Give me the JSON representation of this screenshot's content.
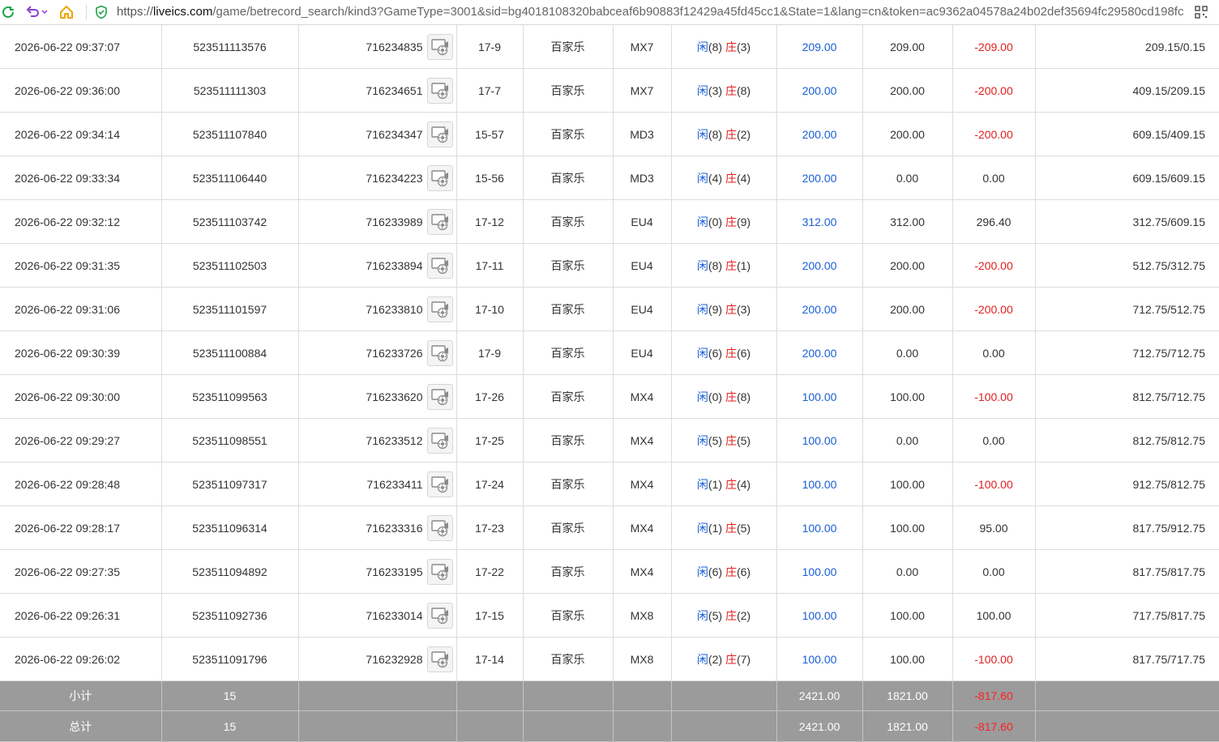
{
  "browser": {
    "url_scheme": "https://",
    "url_host": "liveics.com",
    "url_path": "/game/betrecord_search/kind3?GameType=3001&sid=bg4018108320babceaf6b90883f12429a45fd45cc1&State=1&lang=cn&token=ac9362a04578a24b02def35694fc29580cd198fc"
  },
  "colors": {
    "player": "#1a5fd6",
    "banker": "#e02020",
    "summary_bg": "#9b9b9b"
  },
  "rows": [
    {
      "time": "2026-06-22 09:37:07",
      "bet_id": "523511113576",
      "round_id": "716234835",
      "shoe": "17-9",
      "game": "百家乐",
      "table": "MX7",
      "player_label": "闲",
      "player_score": "(8)",
      "banker_label": "庄",
      "banker_score": "(3)",
      "bet": "209.00",
      "valid": "209.00",
      "win": "-209.00",
      "win_negative": true,
      "balance": "209.15/0.15"
    },
    {
      "time": "2026-06-22 09:36:00",
      "bet_id": "523511111303",
      "round_id": "716234651",
      "shoe": "17-7",
      "game": "百家乐",
      "table": "MX7",
      "player_label": "闲",
      "player_score": "(3)",
      "banker_label": "庄",
      "banker_score": "(8)",
      "bet": "200.00",
      "valid": "200.00",
      "win": "-200.00",
      "win_negative": true,
      "balance": "409.15/209.15"
    },
    {
      "time": "2026-06-22 09:34:14",
      "bet_id": "523511107840",
      "round_id": "716234347",
      "shoe": "15-57",
      "game": "百家乐",
      "table": "MD3",
      "player_label": "闲",
      "player_score": "(8)",
      "banker_label": "庄",
      "banker_score": "(2)",
      "bet": "200.00",
      "valid": "200.00",
      "win": "-200.00",
      "win_negative": true,
      "balance": "609.15/409.15"
    },
    {
      "time": "2026-06-22 09:33:34",
      "bet_id": "523511106440",
      "round_id": "716234223",
      "shoe": "15-56",
      "game": "百家乐",
      "table": "MD3",
      "player_label": "闲",
      "player_score": "(4)",
      "banker_label": "庄",
      "banker_score": "(4)",
      "bet": "200.00",
      "valid": "0.00",
      "win": "0.00",
      "win_negative": false,
      "balance": "609.15/609.15"
    },
    {
      "time": "2026-06-22 09:32:12",
      "bet_id": "523511103742",
      "round_id": "716233989",
      "shoe": "17-12",
      "game": "百家乐",
      "table": "EU4",
      "player_label": "闲",
      "player_score": "(0)",
      "banker_label": "庄",
      "banker_score": "(9)",
      "bet": "312.00",
      "valid": "312.00",
      "win": "296.40",
      "win_negative": false,
      "balance": "312.75/609.15"
    },
    {
      "time": "2026-06-22 09:31:35",
      "bet_id": "523511102503",
      "round_id": "716233894",
      "shoe": "17-11",
      "game": "百家乐",
      "table": "EU4",
      "player_label": "闲",
      "player_score": "(8)",
      "banker_label": "庄",
      "banker_score": "(1)",
      "bet": "200.00",
      "valid": "200.00",
      "win": "-200.00",
      "win_negative": true,
      "balance": "512.75/312.75"
    },
    {
      "time": "2026-06-22 09:31:06",
      "bet_id": "523511101597",
      "round_id": "716233810",
      "shoe": "17-10",
      "game": "百家乐",
      "table": "EU4",
      "player_label": "闲",
      "player_score": "(9)",
      "banker_label": "庄",
      "banker_score": "(3)",
      "bet": "200.00",
      "valid": "200.00",
      "win": "-200.00",
      "win_negative": true,
      "balance": "712.75/512.75"
    },
    {
      "time": "2026-06-22 09:30:39",
      "bet_id": "523511100884",
      "round_id": "716233726",
      "shoe": "17-9",
      "game": "百家乐",
      "table": "EU4",
      "player_label": "闲",
      "player_score": "(6)",
      "banker_label": "庄",
      "banker_score": "(6)",
      "bet": "200.00",
      "valid": "0.00",
      "win": "0.00",
      "win_negative": false,
      "balance": "712.75/712.75"
    },
    {
      "time": "2026-06-22 09:30:00",
      "bet_id": "523511099563",
      "round_id": "716233620",
      "shoe": "17-26",
      "game": "百家乐",
      "table": "MX4",
      "player_label": "闲",
      "player_score": "(0)",
      "banker_label": "庄",
      "banker_score": "(8)",
      "bet": "100.00",
      "valid": "100.00",
      "win": "-100.00",
      "win_negative": true,
      "balance": "812.75/712.75"
    },
    {
      "time": "2026-06-22 09:29:27",
      "bet_id": "523511098551",
      "round_id": "716233512",
      "shoe": "17-25",
      "game": "百家乐",
      "table": "MX4",
      "player_label": "闲",
      "player_score": "(5)",
      "banker_label": "庄",
      "banker_score": "(5)",
      "bet": "100.00",
      "valid": "0.00",
      "win": "0.00",
      "win_negative": false,
      "balance": "812.75/812.75"
    },
    {
      "time": "2026-06-22 09:28:48",
      "bet_id": "523511097317",
      "round_id": "716233411",
      "shoe": "17-24",
      "game": "百家乐",
      "table": "MX4",
      "player_label": "闲",
      "player_score": "(1)",
      "banker_label": "庄",
      "banker_score": "(4)",
      "bet": "100.00",
      "valid": "100.00",
      "win": "-100.00",
      "win_negative": true,
      "balance": "912.75/812.75"
    },
    {
      "time": "2026-06-22 09:28:17",
      "bet_id": "523511096314",
      "round_id": "716233316",
      "shoe": "17-23",
      "game": "百家乐",
      "table": "MX4",
      "player_label": "闲",
      "player_score": "(1)",
      "banker_label": "庄",
      "banker_score": "(5)",
      "bet": "100.00",
      "valid": "100.00",
      "win": "95.00",
      "win_negative": false,
      "balance": "817.75/912.75"
    },
    {
      "time": "2026-06-22 09:27:35",
      "bet_id": "523511094892",
      "round_id": "716233195",
      "shoe": "17-22",
      "game": "百家乐",
      "table": "MX4",
      "player_label": "闲",
      "player_score": "(6)",
      "banker_label": "庄",
      "banker_score": "(6)",
      "bet": "100.00",
      "valid": "0.00",
      "win": "0.00",
      "win_negative": false,
      "balance": "817.75/817.75"
    },
    {
      "time": "2026-06-22 09:26:31",
      "bet_id": "523511092736",
      "round_id": "716233014",
      "shoe": "17-15",
      "game": "百家乐",
      "table": "MX8",
      "player_label": "闲",
      "player_score": "(5)",
      "banker_label": "庄",
      "banker_score": "(2)",
      "bet": "100.00",
      "valid": "100.00",
      "win": "100.00",
      "win_negative": false,
      "balance": "717.75/817.75"
    },
    {
      "time": "2026-06-22 09:26:02",
      "bet_id": "523511091796",
      "round_id": "716232928",
      "shoe": "17-14",
      "game": "百家乐",
      "table": "MX8",
      "player_label": "闲",
      "player_score": "(2)",
      "banker_label": "庄",
      "banker_score": "(7)",
      "bet": "100.00",
      "valid": "100.00",
      "win": "-100.00",
      "win_negative": true,
      "balance": "817.75/717.75"
    }
  ],
  "subtotal": {
    "label": "小计",
    "count": "15",
    "bet": "2421.00",
    "valid": "1821.00",
    "win": "-817.60"
  },
  "total": {
    "label": "总计",
    "count": "15",
    "bet": "2421.00",
    "valid": "1821.00",
    "win": "-817.60"
  }
}
